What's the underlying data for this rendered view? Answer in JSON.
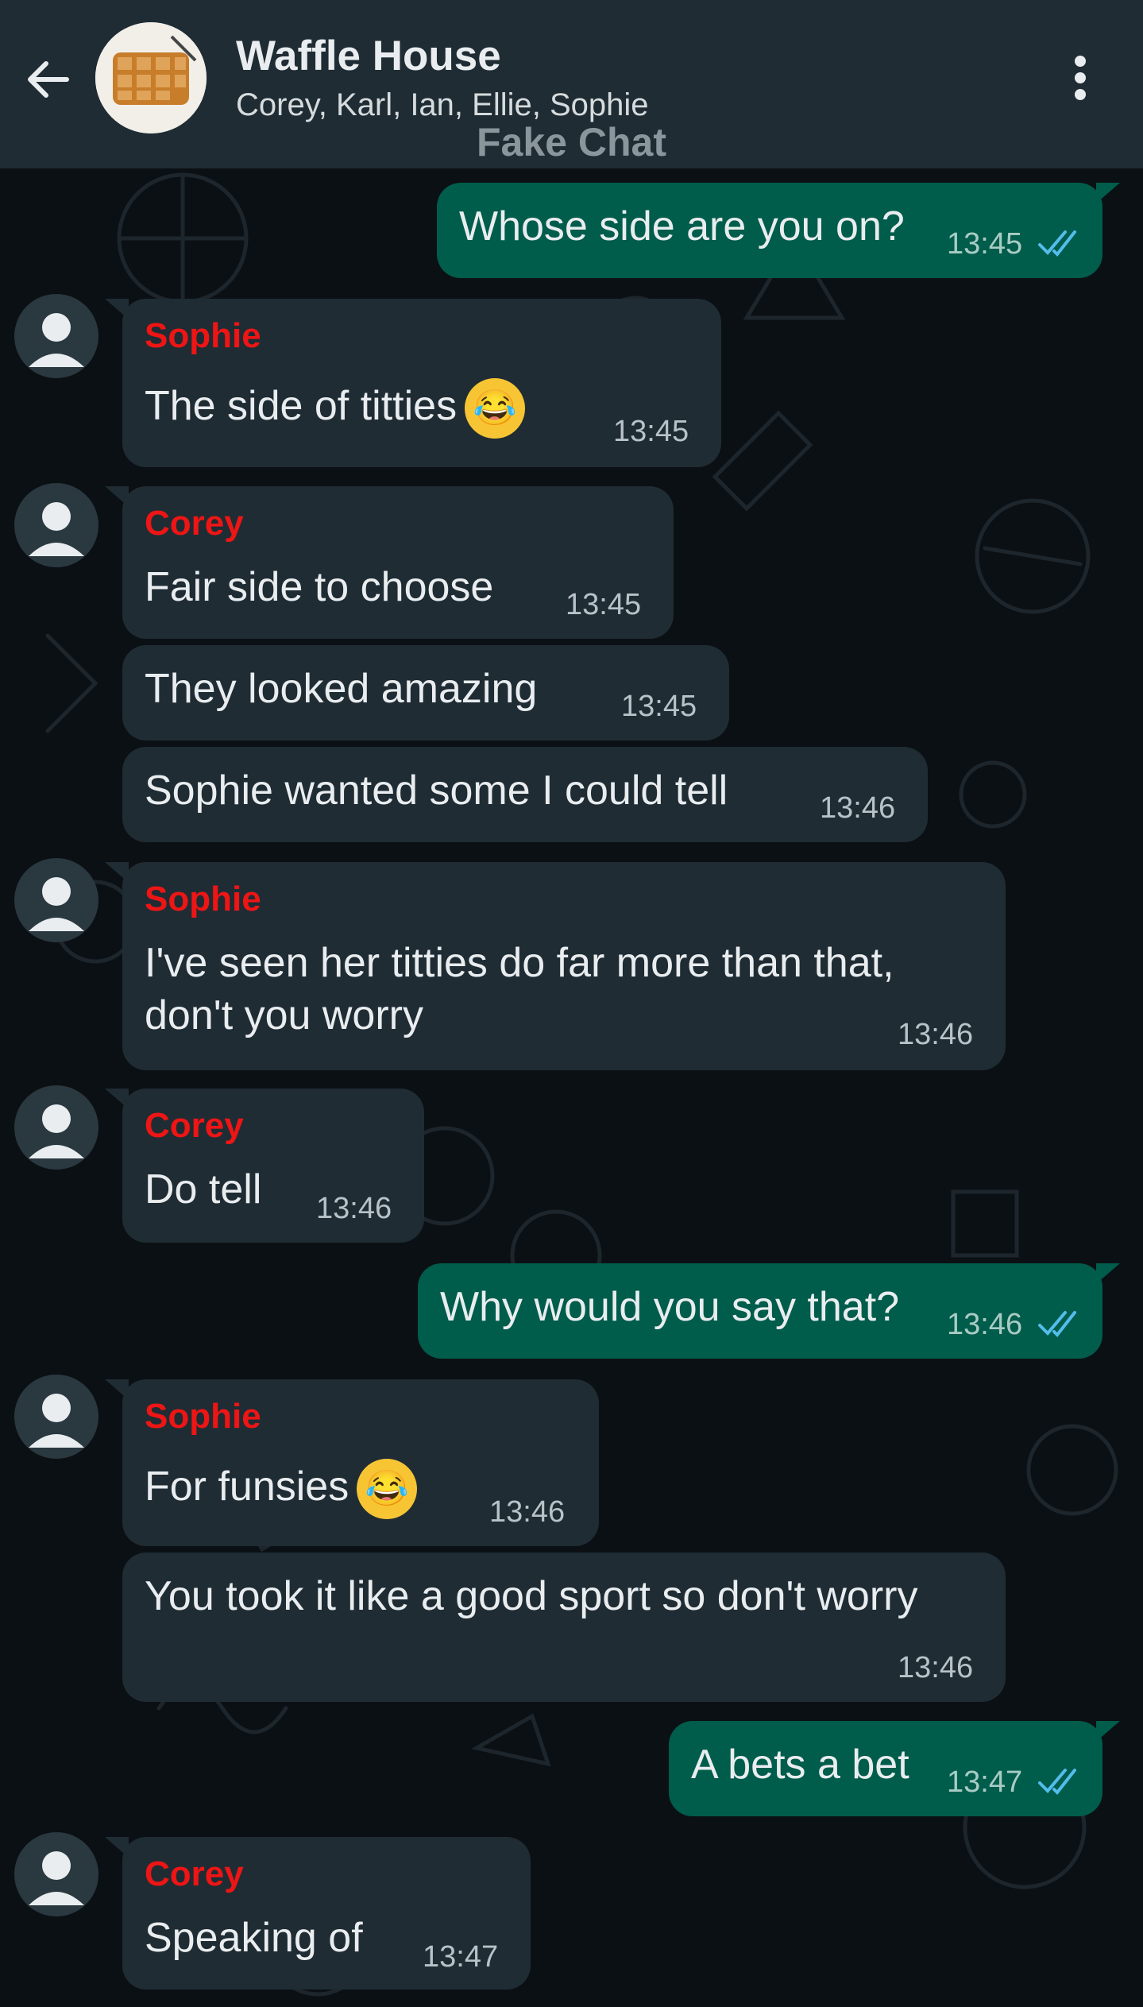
{
  "header": {
    "title": "Waffle House",
    "participants": "Corey, Karl, Ian, Ellie, Sophie",
    "watermark": "Fake Chat",
    "icons": [
      "back-arrow-icon",
      "group-avatar",
      "more-vert-icon"
    ]
  },
  "colors": {
    "background": "#0b1014",
    "header": "#1f2c34",
    "incoming_bubble": "#1f2c34",
    "outgoing_bubble": "#005c4b",
    "sender_name": "#ee1515",
    "read_ticks": "#53bdeb"
  },
  "messages": [
    {
      "dir": "out",
      "text": "Whose side are you on?",
      "time": "13:45",
      "read": true
    },
    {
      "dir": "in",
      "sender": "Sophie",
      "text": "The side of titties",
      "emoji": "rofl",
      "time": "13:45"
    },
    {
      "dir": "in",
      "sender": "Corey",
      "text": "Fair side to choose",
      "time": "13:45"
    },
    {
      "dir": "in",
      "text": "They looked amazing",
      "time": "13:45"
    },
    {
      "dir": "in",
      "text": "Sophie wanted some I could tell",
      "time": "13:46"
    },
    {
      "dir": "in",
      "sender": "Sophie",
      "text_lines": [
        "I've seen her titties do far more than that,",
        "don't you worry"
      ],
      "time": "13:46"
    },
    {
      "dir": "in",
      "sender": "Corey",
      "text": "Do tell",
      "time": "13:46"
    },
    {
      "dir": "out",
      "text": "Why would you say that?",
      "time": "13:46",
      "read": true
    },
    {
      "dir": "in",
      "sender": "Sophie",
      "text": "For funsies",
      "emoji": "rofl",
      "time": "13:46"
    },
    {
      "dir": "in",
      "text": "You took it like a good sport so don't worry",
      "time": "13:46"
    },
    {
      "dir": "out",
      "text": "A bets a bet",
      "time": "13:47",
      "read": true
    },
    {
      "dir": "in",
      "sender": "Corey",
      "text": "Speaking of",
      "time": "13:47"
    }
  ]
}
